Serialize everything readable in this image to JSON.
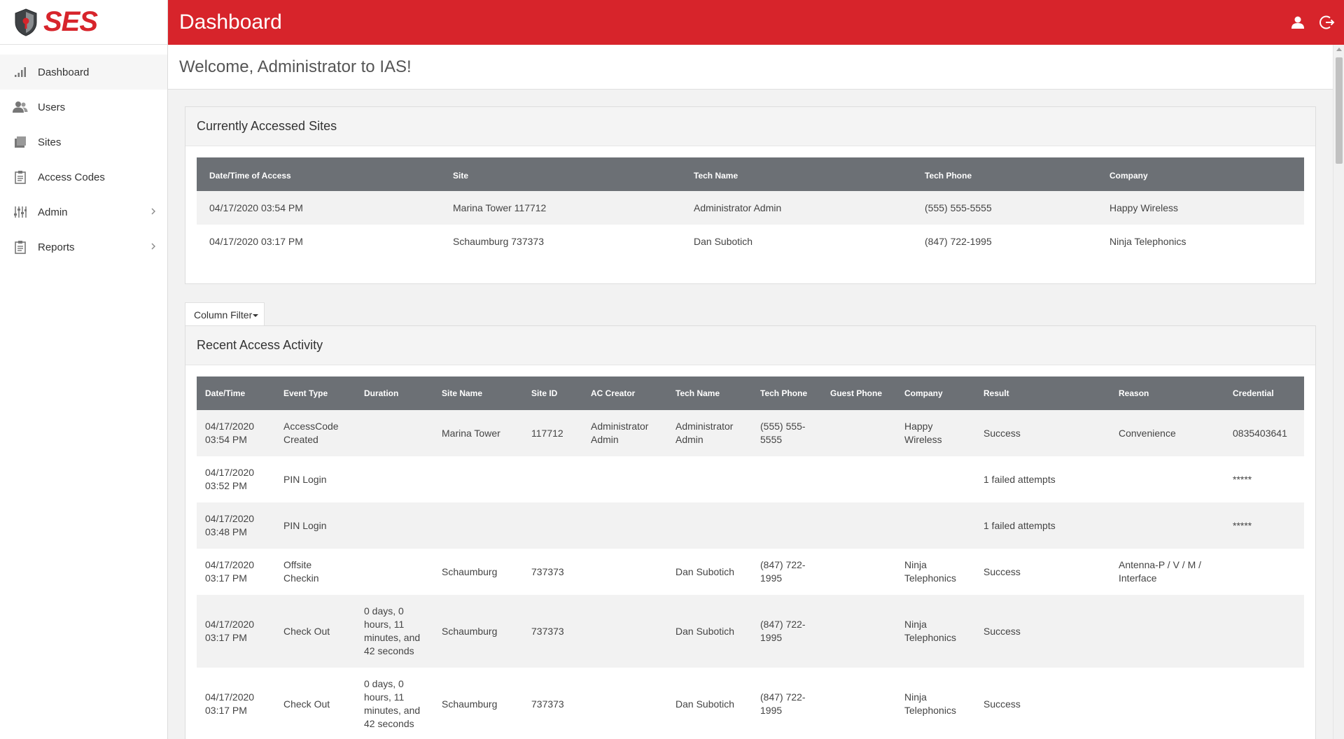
{
  "app": {
    "logo_text": "SES",
    "page_title": "Dashboard",
    "brand_color": "#d7242b"
  },
  "sidebar": {
    "items": [
      {
        "label": "Dashboard",
        "icon": "bar-chart-icon",
        "active": true
      },
      {
        "label": "Users",
        "icon": "users-icon"
      },
      {
        "label": "Sites",
        "icon": "building-icon"
      },
      {
        "label": "Access Codes",
        "icon": "clipboard-icon"
      },
      {
        "label": "Admin",
        "icon": "sliders-icon",
        "has_submenu": true
      },
      {
        "label": "Reports",
        "icon": "report-icon",
        "has_submenu": true
      }
    ]
  },
  "header": {
    "icons": [
      "user-icon",
      "logout-icon"
    ]
  },
  "welcome": {
    "text": "Welcome, Administrator to IAS!"
  },
  "current_sites": {
    "title": "Currently Accessed Sites",
    "columns": [
      "Date/Time of Access",
      "Site",
      "Tech Name",
      "Tech Phone",
      "Company"
    ],
    "rows": [
      [
        "04/17/2020 03:54 PM",
        "Marina Tower 117712",
        "Administrator Admin",
        "(555) 555-5555",
        "Happy Wireless"
      ],
      [
        "04/17/2020 03:17 PM",
        "Schaumburg 737373",
        "Dan Subotich",
        "(847) 722-1995",
        "Ninja Telephonics"
      ]
    ]
  },
  "column_filter": {
    "label": "Column Filter"
  },
  "recent_activity": {
    "title": "Recent Access Activity",
    "columns": [
      "Date/Time",
      "Event Type",
      "Duration",
      "Site Name",
      "Site ID",
      "AC Creator",
      "Tech Name",
      "Tech Phone",
      "Guest Phone",
      "Company",
      "Result",
      "Reason",
      "Credential"
    ],
    "rows": [
      [
        "04/17/2020 03:54 PM",
        "AccessCode Created",
        "",
        "Marina Tower",
        "117712",
        "Administrator Admin",
        "Administrator Admin",
        "(555) 555-5555",
        "",
        "Happy Wireless",
        "Success",
        "Convenience",
        "0835403641"
      ],
      [
        "04/17/2020 03:52 PM",
        "PIN Login",
        "",
        "",
        "",
        "",
        "",
        "",
        "",
        "",
        "1 failed attempts",
        "",
        "*****"
      ],
      [
        "04/17/2020 03:48 PM",
        "PIN Login",
        "",
        "",
        "",
        "",
        "",
        "",
        "",
        "",
        "1 failed attempts",
        "",
        "*****"
      ],
      [
        "04/17/2020 03:17 PM",
        "Offsite Checkin",
        "",
        "Schaumburg",
        "737373",
        "",
        "Dan Subotich",
        "(847) 722-1995",
        "",
        "Ninja Telephonics",
        "Success",
        "Antenna-P / V / M / Interface",
        ""
      ],
      [
        "04/17/2020 03:17 PM",
        "Check Out",
        "0 days, 0 hours, 11 minutes, and 42 seconds",
        "Schaumburg",
        "737373",
        "",
        "Dan Subotich",
        "(847) 722-1995",
        "",
        "Ninja Telephonics",
        "Success",
        "",
        ""
      ],
      [
        "04/17/2020 03:17 PM",
        "Check Out",
        "0 days, 0 hours, 11 minutes, and 42 seconds",
        "Schaumburg",
        "737373",
        "",
        "Dan Subotich",
        "(847) 722-1995",
        "",
        "Ninja Telephonics",
        "Success",
        "",
        ""
      ]
    ]
  }
}
